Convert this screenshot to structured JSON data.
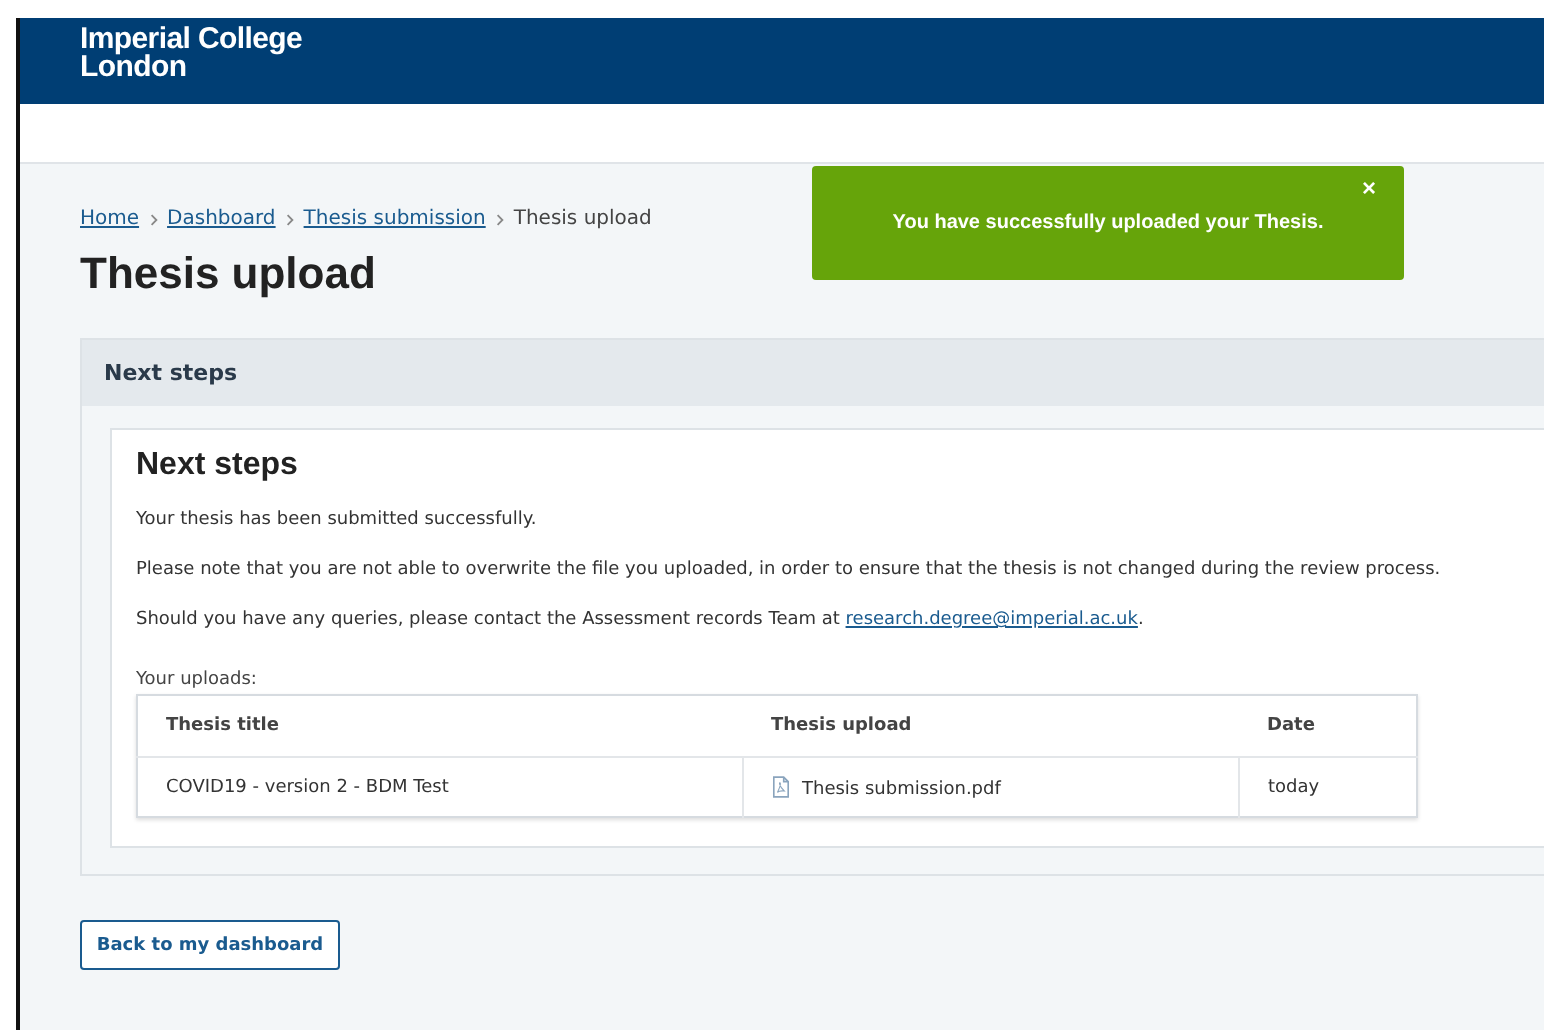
{
  "header": {
    "logo_lines": [
      "Imperial College",
      "London"
    ]
  },
  "breadcrumb": {
    "links": [
      "Home",
      "Dashboard",
      "Thesis submission"
    ],
    "current": "Thesis upload"
  },
  "page_title": "Thesis upload",
  "toast": {
    "message": "You have successfully uploaded your Thesis.",
    "close": "×"
  },
  "panel": {
    "heading": "Next steps",
    "card": {
      "title": "Next steps",
      "paragraphs": [
        {
          "text": "Your thesis has been submitted successfully."
        },
        {
          "text": "Please note that you are not able to overwrite the file you uploaded, in order to ensure that the thesis is not changed during the review process."
        },
        {
          "text": "Should you have any queries, please contact the Assessment records Team at ",
          "link": "research.degree@imperial.ac.uk",
          "after": "."
        }
      ],
      "uploads_label": "Your uploads:",
      "table": {
        "columns": [
          "Thesis title",
          "Thesis upload",
          "Date"
        ],
        "rows": [
          {
            "title": "COVID19 - version 2 - BDM Test",
            "file": "Thesis submission.pdf",
            "date": "today"
          }
        ]
      }
    }
  },
  "back_button": "Back to my dashboard"
}
